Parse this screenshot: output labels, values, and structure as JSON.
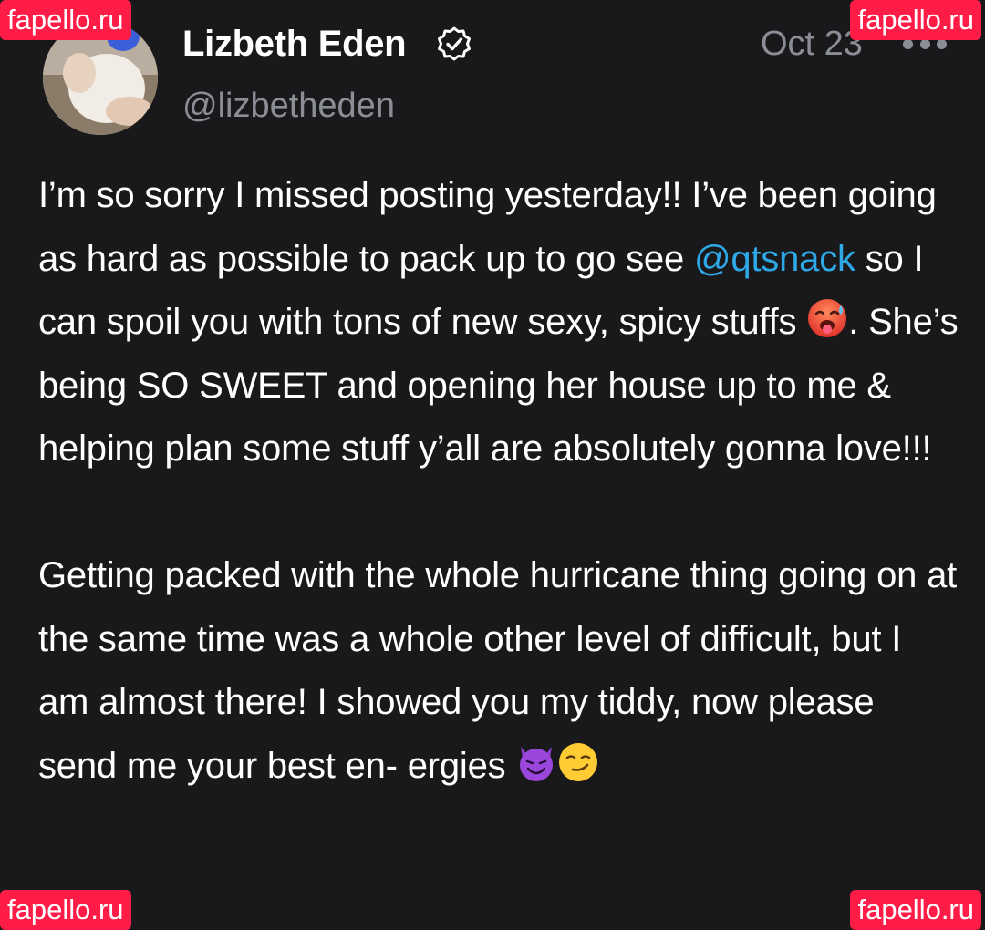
{
  "post": {
    "author": {
      "display_name": "Lizbeth Eden",
      "handle": "@lizbetheden",
      "verified": true,
      "avatar_icon": "profile-photo"
    },
    "timestamp": "Oct 23",
    "more_icon": "more-horizontal-icon",
    "paragraph1": {
      "part1": "I’m so sorry I missed posting yesterday!! I’ve been going as hard as possible to pack up to go see ",
      "mention": "@qtsnack",
      "part2": " so I can spoil you with tons of new sexy, spicy stuffs ",
      "emoji": "hot-face-emoji",
      "part3": ". She’s being SO SWEET and opening her house up to me & helping plan some stuff y’all are absolutely gonna love!!!"
    },
    "paragraph2": {
      "text": "Getting packed with the whole hurricane thing going on at the same time was a whole other level of difficult, but I am almost there! I showed you my tiddy, now please send me your best en- ergies ",
      "emojis": [
        "smiling-devil-emoji",
        "smirk-emoji"
      ]
    }
  },
  "watermark": {
    "text": "fapello.ru",
    "color": "#ff1d48"
  },
  "colors": {
    "background": "#19191b",
    "mention": "#2ea8e6",
    "secondary_text": "#8b8e96"
  }
}
